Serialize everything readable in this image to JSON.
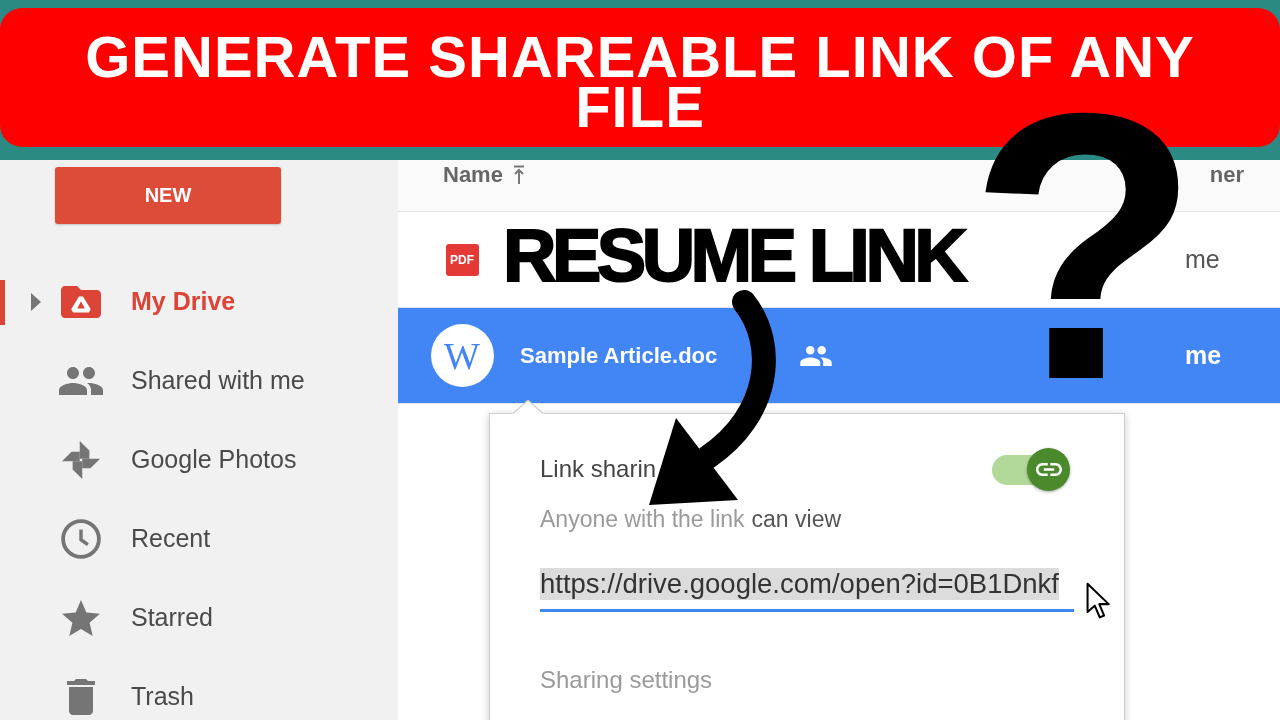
{
  "banner": {
    "title": "GENERATE SHAREABLE LINK OF ANY FILE"
  },
  "sidebar": {
    "new_button": "NEW",
    "items": [
      {
        "label": "My Drive",
        "selected": true,
        "expanded": false
      },
      {
        "label": "Shared with me",
        "selected": false
      },
      {
        "label": "Google Photos",
        "selected": false
      },
      {
        "label": "Recent",
        "selected": false
      },
      {
        "label": "Starred",
        "selected": false
      },
      {
        "label": "Trash",
        "selected": false
      }
    ]
  },
  "table": {
    "columns": [
      {
        "label": "Name",
        "sorted": true
      },
      {
        "label": "ner",
        "sorted": false
      }
    ],
    "rows": [
      {
        "kind": "pdf",
        "icon_text": "PDF",
        "shared": false,
        "owner": "me",
        "selected": false
      },
      {
        "kind": "doc",
        "icon_text": "W",
        "name": "Sample Article.doc",
        "shared": true,
        "owner": "me",
        "selected": true
      }
    ]
  },
  "share_popup": {
    "title": "Link sharin",
    "on": true,
    "access_text": "Anyone with the link",
    "access_level": "can view",
    "link": "https://drive.google.com/open?id=0B1Dnkf",
    "link_selected": true,
    "settings_link": "Sharing settings"
  },
  "overlays": {
    "callout": "RESUME LINK",
    "question_mark": "?"
  }
}
